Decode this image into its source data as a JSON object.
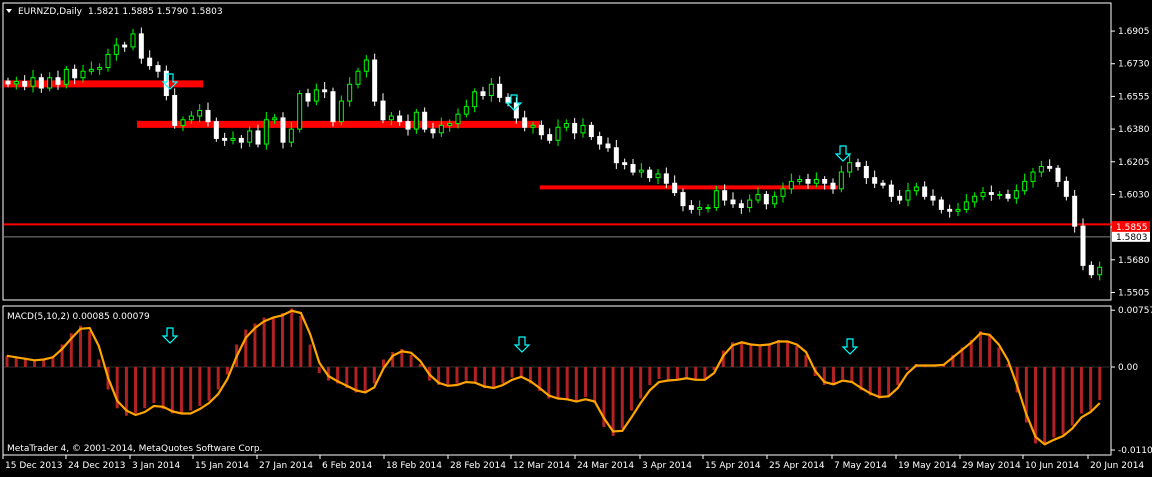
{
  "window": {
    "symbol_label": "EURNZD,Daily",
    "ohlc_label": "1.5821 1.5885 1.5790 1.5803"
  },
  "indicator": {
    "label": "MACD(5,10,2) 0.00085 0.00079"
  },
  "copyright": "MetaTrader 4, © 2001-2014, MetaQuotes Software Corp.",
  "colors": {
    "background": "#000000",
    "frame": "#ffffff",
    "bull_candle": "#00ff00",
    "bear_candle": "#ffffff",
    "sr_line": "#ff0000",
    "macd_hist": "#b22222",
    "macd_signal": "#ffa500",
    "arrow": "#00ffff",
    "price_tag": "#ff0000"
  },
  "chart_data": [
    {
      "type": "candlestick",
      "panel": "price",
      "ylim": [
        1.547,
        1.705
      ],
      "y_ticks": [
        "1.6905",
        "1.6730",
        "1.6555",
        "1.6380",
        "1.6205",
        "1.6030",
        "1.5855",
        "1.5680",
        "1.5505"
      ],
      "y_tick_values": [
        1.6905,
        1.673,
        1.6555,
        1.638,
        1.6205,
        1.603,
        1.5855,
        1.568,
        1.5505
      ],
      "current_price": "1.5803",
      "current_price_value": 1.5803,
      "red_tag": "1.5855",
      "red_tag_value": 1.5855,
      "bars": 132,
      "closes": [
        1.6622,
        1.6635,
        1.661,
        1.6655,
        1.66,
        1.6655,
        1.662,
        1.67,
        1.6655,
        1.669,
        1.67,
        1.671,
        1.678,
        1.683,
        1.682,
        1.689,
        1.676,
        1.672,
        1.669,
        1.656,
        1.64,
        1.643,
        1.645,
        1.648,
        1.642,
        1.633,
        1.632,
        1.633,
        1.631,
        1.637,
        1.63,
        1.643,
        1.644,
        1.631,
        1.638,
        1.657,
        1.653,
        1.659,
        1.658,
        1.642,
        1.653,
        1.662,
        1.669,
        1.675,
        1.653,
        1.643,
        1.645,
        1.642,
        1.638,
        1.647,
        1.638,
        1.636,
        1.64,
        1.641,
        1.646,
        1.65,
        1.658,
        1.656,
        1.662,
        1.655,
        1.652,
        1.644,
        1.639,
        1.64,
        1.635,
        1.632,
        1.639,
        1.641,
        1.636,
        1.64,
        1.634,
        1.63,
        1.628,
        1.62,
        1.619,
        1.615,
        1.616,
        1.612,
        1.614,
        1.609,
        1.604,
        1.597,
        1.595,
        1.596,
        1.596,
        1.605,
        1.6,
        1.598,
        1.596,
        1.6,
        1.603,
        1.598,
        1.602,
        1.606,
        1.61,
        1.611,
        1.609,
        1.611,
        1.609,
        1.606,
        1.615,
        1.62,
        1.618,
        1.612,
        1.609,
        1.608,
        1.602,
        1.6,
        1.605,
        1.607,
        1.602,
        1.6,
        1.595,
        1.594,
        1.595,
        1.599,
        1.602,
        1.604,
        1.603,
        1.603,
        1.601,
        1.605,
        1.61,
        1.615,
        1.618,
        1.617,
        1.61,
        1.602,
        1.586,
        1.565,
        1.56,
        1.564
      ]
    },
    {
      "type": "histogram+line",
      "panel": "macd",
      "ylim": [
        -0.0116,
        0.008
      ],
      "y_ticks": [
        "0.00757",
        "0.00",
        "-0.01107"
      ],
      "y_tick_values": [
        0.00757,
        0.0,
        -0.01107
      ],
      "x_ticks": [
        "15 Dec 2013",
        "24 Dec 2013",
        "3 Jan 2014",
        "15 Jan 2014",
        "27 Jan 2014",
        "6 Feb 2014",
        "18 Feb 2014",
        "28 Feb 2014",
        "12 Mar 2014",
        "24 Mar 2014",
        "3 Apr 2014",
        "15 Apr 2014",
        "25 Apr 2014",
        "7 May 2014",
        "19 May 2014",
        "29 May 2014",
        "10 Jun 2014",
        "20 Jun 2014"
      ],
      "x_tick_bars": [
        0,
        9,
        17,
        27,
        37,
        46,
        56,
        65,
        75,
        85,
        94,
        104,
        113,
        123,
        133,
        143,
        152,
        162
      ],
      "histogram": [
        0.0015,
        0.0012,
        0.001,
        0.0008,
        0.001,
        0.0015,
        0.003,
        0.0045,
        0.0055,
        0.0048,
        0.001,
        -0.003,
        -0.0055,
        -0.0065,
        -0.0062,
        -0.0055,
        -0.0048,
        -0.0056,
        -0.0062,
        -0.0062,
        -0.0058,
        -0.0052,
        -0.0045,
        -0.003,
        -0.001,
        0.003,
        0.005,
        0.0058,
        0.0066,
        0.0067,
        0.0072,
        0.0078,
        0.0068,
        0.003,
        -0.0008,
        -0.0018,
        -0.0022,
        -0.0028,
        -0.0034,
        -0.0034,
        -0.0022,
        0.001,
        0.002,
        0.0024,
        0.0016,
        0.0004,
        -0.0018,
        -0.0024,
        -0.0026,
        -0.0022,
        -0.0018,
        -0.0022,
        -0.0028,
        -0.0028,
        -0.0022,
        -0.0014,
        -0.0012,
        -0.0022,
        -0.0032,
        -0.0042,
        -0.0042,
        -0.0044,
        -0.0046,
        -0.004,
        -0.0048,
        -0.008,
        -0.0092,
        -0.0082,
        -0.0058,
        -0.0042,
        -0.0024,
        -0.0016,
        -0.0018,
        -0.0016,
        -0.0014,
        -0.0018,
        -0.0016,
        -0.0004,
        0.0022,
        0.0033,
        0.0034,
        0.0029,
        0.0029,
        0.0031,
        0.0036,
        0.0034,
        0.0028,
        0.0016,
        -0.0012,
        -0.0024,
        -0.0024,
        -0.0016,
        -0.0021,
        -0.0031,
        -0.0038,
        -0.0042,
        -0.0038,
        -0.0024,
        -0.0004,
        0.0004,
        0.0002,
        0.0002,
        0.0004,
        0.0016,
        0.0026,
        0.0036,
        0.0048,
        0.0042,
        0.0026,
        0.0004,
        -0.0034,
        -0.0074,
        -0.0102,
        -0.0104,
        -0.0094,
        -0.009,
        -0.0078,
        -0.0062,
        -0.0058,
        -0.0044
      ],
      "signal": [
        0.0015,
        0.0013,
        0.0011,
        0.0009,
        0.001,
        0.0013,
        0.0024,
        0.0038,
        0.0051,
        0.0052,
        0.0028,
        -0.0014,
        -0.0045,
        -0.0058,
        -0.0064,
        -0.006,
        -0.0052,
        -0.0053,
        -0.0059,
        -0.0062,
        -0.0062,
        -0.0056,
        -0.0048,
        -0.0036,
        -0.0016,
        0.0014,
        0.0039,
        0.0052,
        0.0061,
        0.0066,
        0.0069,
        0.0075,
        0.0072,
        0.0044,
        0.0006,
        -0.0012,
        -0.0019,
        -0.0025,
        -0.0031,
        -0.0034,
        -0.0027,
        -0.0002,
        0.0015,
        0.0021,
        0.0019,
        0.0008,
        -0.001,
        -0.0021,
        -0.0025,
        -0.0024,
        -0.002,
        -0.0021,
        -0.0026,
        -0.0028,
        -0.0024,
        -0.0017,
        -0.0013,
        -0.0019,
        -0.0028,
        -0.0038,
        -0.0042,
        -0.0043,
        -0.0046,
        -0.0043,
        -0.0046,
        -0.0068,
        -0.0086,
        -0.0085,
        -0.0067,
        -0.0048,
        -0.0031,
        -0.002,
        -0.0018,
        -0.0017,
        -0.0015,
        -0.0017,
        -0.0017,
        -0.0008,
        0.0015,
        0.0029,
        0.0033,
        0.003,
        0.0029,
        0.003,
        0.0034,
        0.0034,
        0.003,
        0.002,
        -0.0005,
        -0.002,
        -0.0023,
        -0.0018,
        -0.002,
        -0.0028,
        -0.0035,
        -0.004,
        -0.0039,
        -0.0028,
        -0.0009,
        0.0002,
        0.0002,
        0.0002,
        0.0003,
        0.0013,
        0.0023,
        0.0033,
        0.0045,
        0.0043,
        0.003,
        0.0009,
        -0.0025,
        -0.0063,
        -0.0093,
        -0.0103,
        -0.0097,
        -0.0092,
        -0.0082,
        -0.0067,
        -0.006,
        -0.0048
      ]
    }
  ],
  "levels": {
    "resistance_1": 1.6622,
    "resistance_2": 1.6405,
    "support_mid": 1.6068,
    "support_key": 1.587
  }
}
